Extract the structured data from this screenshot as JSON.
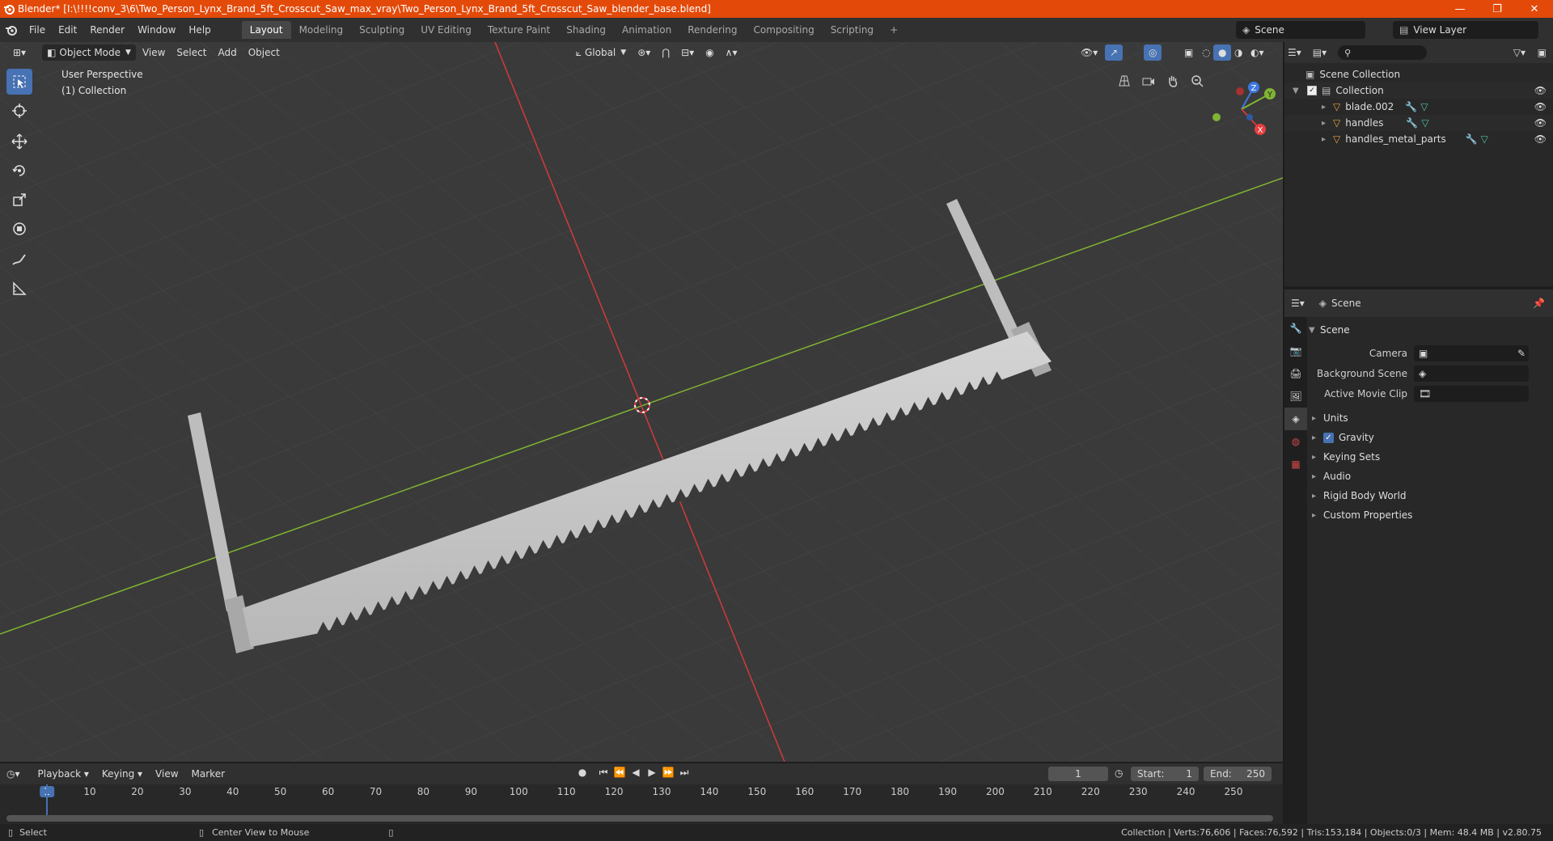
{
  "titlebar": {
    "title": "Blender* [I:\\!!!!conv_3\\6\\Two_Person_Lynx_Brand_5ft_Crosscut_Saw_max_vray\\Two_Person_Lynx_Brand_5ft_Crosscut_Saw_blender_base.blend]",
    "minimize": "—",
    "maximize": "❐",
    "close": "✕"
  },
  "menus": [
    "File",
    "Edit",
    "Render",
    "Window",
    "Help"
  ],
  "workspaces": [
    "Layout",
    "Modeling",
    "Sculpting",
    "UV Editing",
    "Texture Paint",
    "Shading",
    "Animation",
    "Rendering",
    "Compositing",
    "Scripting"
  ],
  "active_workspace": "Layout",
  "scene_name": "Scene",
  "view_layer": "View Layer",
  "viewport": {
    "mode": "Object Mode",
    "menus": [
      "View",
      "Select",
      "Add",
      "Object"
    ],
    "transform_orientation": "Global",
    "perspective": "User Perspective",
    "collection": "(1) Collection"
  },
  "gizmo": {
    "z": "Z",
    "y": "Y",
    "x": "X"
  },
  "outliner": {
    "root": "Scene Collection",
    "collection": "Collection",
    "objects": [
      "blade.002",
      "handles",
      "handles_metal_parts"
    ]
  },
  "properties": {
    "header": "Scene",
    "panel": "Scene",
    "camera_label": "Camera",
    "background_label": "Background Scene",
    "movieclip_label": "Active Movie Clip",
    "subpanels": [
      "Units",
      "Gravity",
      "Keying Sets",
      "Audio",
      "Rigid Body World",
      "Custom Properties"
    ]
  },
  "timeline": {
    "menus": [
      "Playback",
      "Keying",
      "View",
      "Marker"
    ],
    "current_frame": "1",
    "start_label": "Start:",
    "start": "1",
    "end_label": "End:",
    "end": "250",
    "ticks": [
      "1",
      "10",
      "20",
      "30",
      "40",
      "50",
      "60",
      "70",
      "80",
      "90",
      "100",
      "110",
      "120",
      "130",
      "140",
      "150",
      "160",
      "170",
      "180",
      "190",
      "200",
      "210",
      "220",
      "230",
      "240",
      "250"
    ]
  },
  "statusbar": {
    "left": "Select",
    "middle": "Center View to Mouse",
    "stats": "Collection | Verts:76,606 | Faces:76,592 | Tris:153,184 | Objects:0/3 | Mem: 48.4 MB | v2.80.75"
  },
  "colors": {
    "accent": "#4772b3",
    "titlebar": "#e34a0a",
    "x_axis": "#d23a3a",
    "y_axis": "#80b432",
    "z_axis": "#3c78e0"
  }
}
